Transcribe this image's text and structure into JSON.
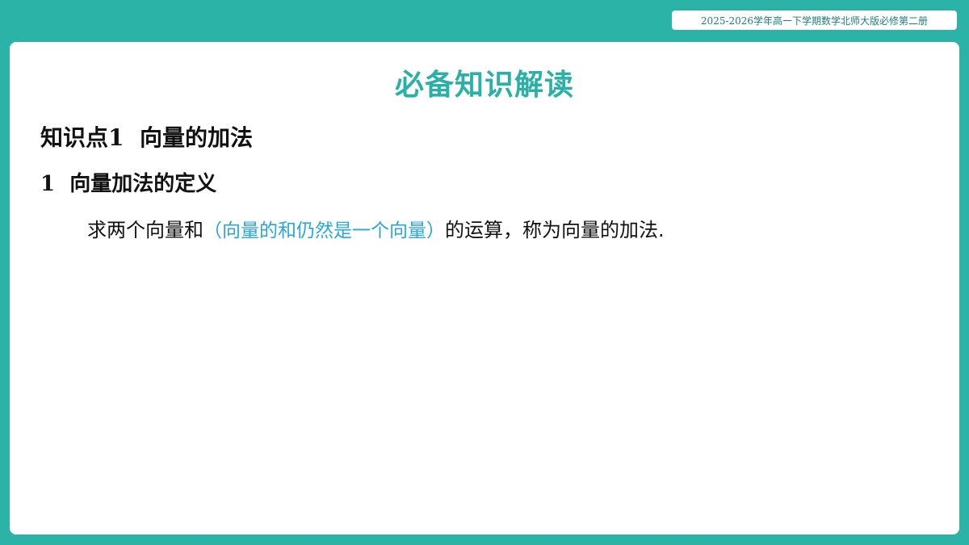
{
  "header": {
    "badge": "2025-2026学年高一下学期数学北师大版必修第二册"
  },
  "slide": {
    "title": "必备知识解读",
    "section_heading": "知识点1  向量的加法",
    "sub_heading": "1  向量加法的定义",
    "definition": {
      "before": "求两个向量和",
      "note": "（向量的和仍然是一个向量）",
      "after": "的运算，称为向量的加法."
    }
  },
  "colors": {
    "background": "#2bb3a8",
    "title": "#2ab0a6",
    "note": "#2aa6d9"
  }
}
